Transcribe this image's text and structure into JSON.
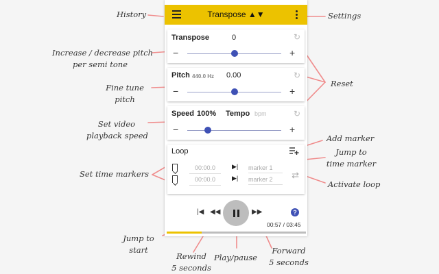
{
  "header": {
    "title": "Transpose ▲▼"
  },
  "transpose": {
    "label": "Transpose",
    "value": "0",
    "slider": 0.5
  },
  "pitch": {
    "label": "Pitch",
    "hz": "440.0 Hz",
    "value": "0.00",
    "slider": 0.5
  },
  "speed": {
    "label": "Speed",
    "value": "100%",
    "tempo_label": "Tempo",
    "tempo_placeholder": "bpm",
    "slider": 0.22
  },
  "loop": {
    "label": "Loop",
    "markers": [
      {
        "time": "00:00.0",
        "name": "marker 1"
      },
      {
        "time": "00:00.0",
        "name": "marker 2"
      }
    ]
  },
  "player": {
    "time": "00:57 / 03:45",
    "progress": 0.253
  },
  "annotations": {
    "history": "History",
    "settings": "Settings",
    "increase_l1": "Increase / decrease pitch",
    "increase_l2": "per semi tone",
    "reset": "Reset",
    "fine_l1": "Fine tune",
    "fine_l2": "pitch",
    "speed_l1": "Set video",
    "speed_l2": "playback speed",
    "add_marker": "Add marker",
    "jump_marker_l1": "Jump to",
    "jump_marker_l2": "time marker",
    "set_markers": "Set time markers",
    "activate_loop": "Activate loop",
    "jump_start_l1": "Jump to",
    "jump_start_l2": "start",
    "rewind_l1": "Rewind",
    "rewind_l2": "5 seconds",
    "playpause": "Play/pause",
    "forward_l1": "Forward",
    "forward_l2": "5 seconds"
  },
  "colors": {
    "accent": "#ecc200",
    "slider": "#3f51b5",
    "annotation_arrow": "#f08c8c"
  }
}
